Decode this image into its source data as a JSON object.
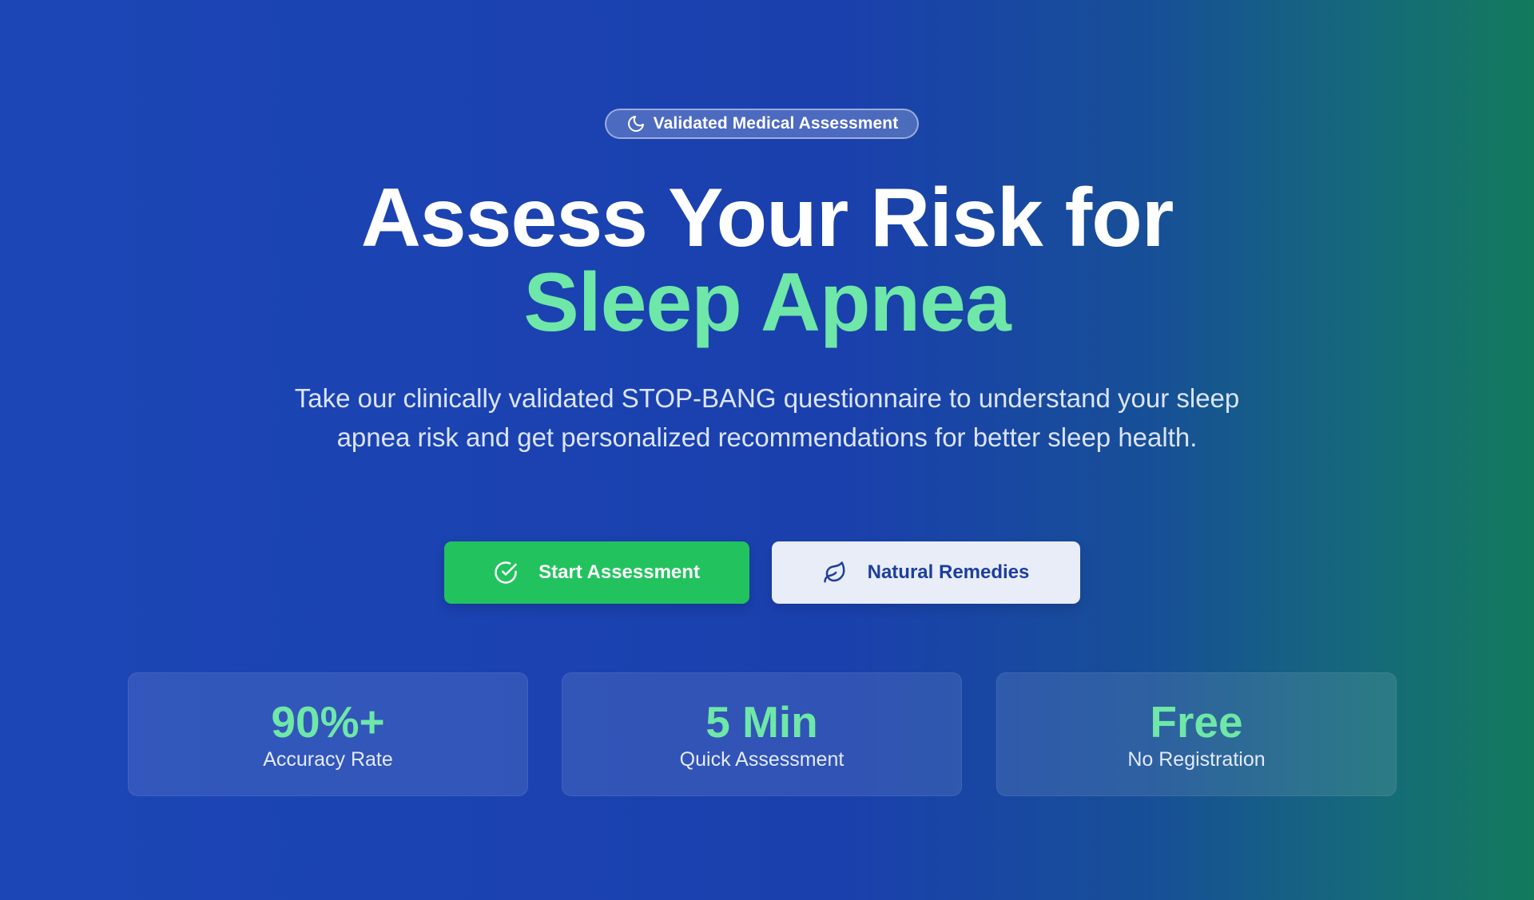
{
  "badge": {
    "icon": "moon-icon",
    "text": "Validated Medical Assessment"
  },
  "headline": {
    "line1": "Assess Your Risk for",
    "line2": "Sleep Apnea"
  },
  "subtitle": "Take our clinically validated STOP-BANG questionnaire to understand your sleep apnea risk and get personalized recommendations for better sleep health.",
  "buttons": {
    "primary": {
      "label": "Start Assessment",
      "icon": "check-circle-icon"
    },
    "secondary": {
      "label": "Natural Remedies",
      "icon": "leaf-icon"
    }
  },
  "stats": [
    {
      "value": "90%+",
      "label": "Accuracy Rate"
    },
    {
      "value": "5 Min",
      "label": "Quick Assessment"
    },
    {
      "value": "Free",
      "label": "No Registration"
    }
  ],
  "colors": {
    "accent_green": "#6ee7a8",
    "primary_button": "#22c35e",
    "background_blue": "#1c46b6",
    "background_teal": "#137a5c"
  }
}
